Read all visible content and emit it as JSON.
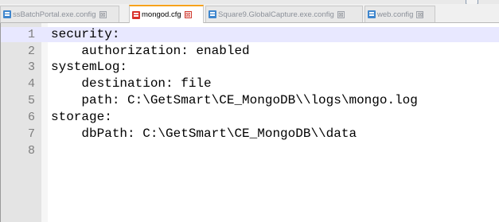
{
  "tabs": [
    {
      "label": "ssBatchPortal.exe.config",
      "active": false,
      "icon": "file-icon",
      "close": "⊠"
    },
    {
      "label": "mongod.cfg",
      "active": true,
      "icon": "file-modified-icon",
      "close": "⊠"
    },
    {
      "label": "Square9.GlobalCapture.exe.config",
      "active": false,
      "icon": "file-icon",
      "close": "⊠"
    },
    {
      "label": "web.config",
      "active": false,
      "icon": "file-icon",
      "close": "⊠"
    }
  ],
  "editor": {
    "current_line": 1,
    "lines": [
      {
        "num": "1",
        "text": "security:"
      },
      {
        "num": "2",
        "text": "    authorization: enabled"
      },
      {
        "num": "3",
        "text": "systemLog:"
      },
      {
        "num": "4",
        "text": "    destination: file"
      },
      {
        "num": "5",
        "text": "    path: C:\\GetSmart\\CE_MongoDB\\\\logs\\mongo.log"
      },
      {
        "num": "6",
        "text": "storage:"
      },
      {
        "num": "7",
        "text": "    dbPath: C:\\GetSmart\\CE_MongoDB\\\\data"
      },
      {
        "num": "8",
        "text": ""
      }
    ]
  },
  "colors": {
    "active_tab_accent": "#f7a21b",
    "modified_icon": "#d9312b",
    "saved_icon": "#3f86cd",
    "current_line_highlight": "#e8e8ff"
  }
}
